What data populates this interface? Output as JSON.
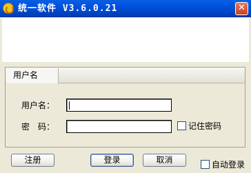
{
  "window": {
    "title": "统一软件 V3.6.0.21",
    "close_glyph": "✕",
    "icon": "app-logo-icon"
  },
  "panel": {
    "tab_label": "用户名",
    "username_label": "用户名：",
    "username_value": "",
    "password_label": "密　码：",
    "password_value": "",
    "remember_label": "记住密码",
    "remember_checked": false
  },
  "footer": {
    "register_label": "注册",
    "login_label": "登录",
    "cancel_label": "取消",
    "auto_login_label": "自动登录",
    "auto_login_checked": false
  },
  "colors": {
    "titlebar": "#0054E3",
    "close_button": "#C8431F",
    "window_bg": "#ECE9D8"
  }
}
